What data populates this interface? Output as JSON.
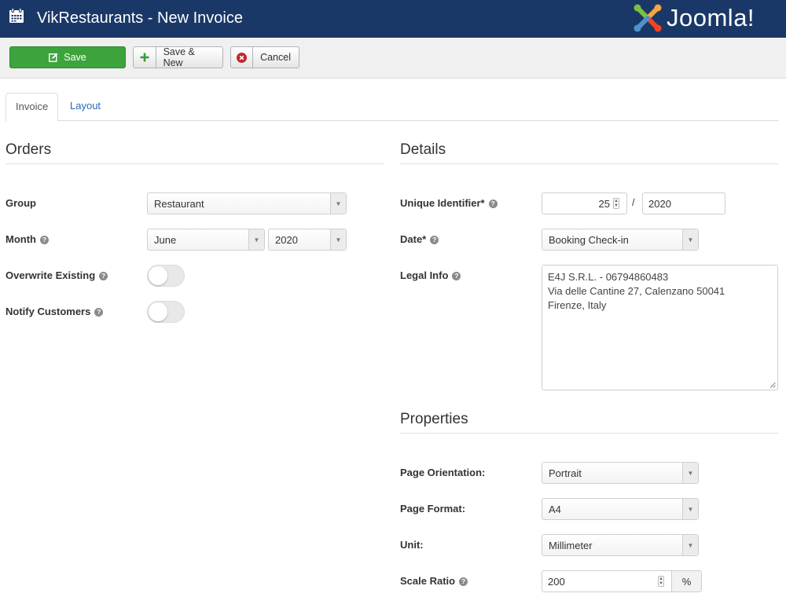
{
  "header": {
    "title": "VikRestaurants - New Invoice",
    "logo_text": "Joomla!",
    "bg_color": "#1a3867"
  },
  "toolbar": {
    "save_label": "Save",
    "save_new_label": "Save & New",
    "cancel_label": "Cancel",
    "save_color": "#3da43d"
  },
  "tabs": [
    {
      "label": "Invoice",
      "active": true
    },
    {
      "label": "Layout",
      "active": false
    }
  ],
  "orders": {
    "title": "Orders",
    "group_label": "Group",
    "group_value": "Restaurant",
    "month_label": "Month",
    "month_value": "June",
    "year_value": "2020",
    "overwrite_label": "Overwrite Existing",
    "overwrite_on": false,
    "notify_label": "Notify Customers",
    "notify_on": false
  },
  "details": {
    "title": "Details",
    "uid_label": "Unique Identifier*",
    "uid_number": "25",
    "uid_separator": "/",
    "uid_suffix": "2020",
    "date_label": "Date*",
    "date_value": "Booking Check-in",
    "legal_label": "Legal Info",
    "legal_lines": [
      "E4J S.R.L. - 06794860483",
      "Via delle Cantine 27, Calenzano 50041",
      "Firenze, Italy"
    ]
  },
  "properties": {
    "title": "Properties",
    "orientation_label": "Page Orientation:",
    "orientation_value": "Portrait",
    "format_label": "Page Format:",
    "format_value": "A4",
    "unit_label": "Unit:",
    "unit_value": "Millimeter",
    "scale_label": "Scale Ratio",
    "scale_value": "200",
    "scale_unit": "%"
  },
  "icons": {
    "app": "calendar-icon",
    "save": "edit-icon",
    "save_new": "plus-icon",
    "cancel": "cancel-circle-icon",
    "help": "question-circle-icon",
    "select_arrow": "caret-down-icon"
  }
}
